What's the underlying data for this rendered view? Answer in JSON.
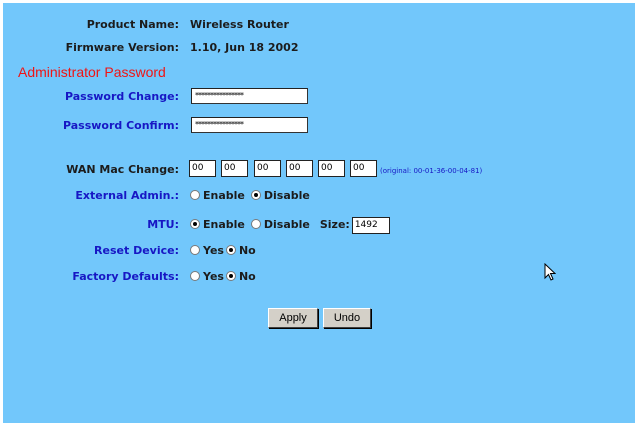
{
  "product": {
    "label": "Product Name:",
    "value": "Wireless Router"
  },
  "firmware": {
    "label": "Firmware Version:",
    "value": "1.10, Jun 18 2002"
  },
  "section_title": "Administrator Password",
  "password_change": {
    "label": "Password Change:",
    "value": "****************"
  },
  "password_confirm": {
    "label": "Password Confirm:",
    "value": "****************"
  },
  "wan_mac": {
    "label": "WAN Mac Change:",
    "octets": [
      "00",
      "00",
      "00",
      "00",
      "00",
      "00"
    ],
    "original_note": "(original: 00-01-36-00-04-81)"
  },
  "external_admin": {
    "label": "External Admin.:",
    "enable": "Enable",
    "disable": "Disable",
    "selected": "Disable"
  },
  "mtu": {
    "label": "MTU:",
    "enable": "Enable",
    "disable": "Disable",
    "selected": "Enable",
    "size_label": "Size:",
    "size_value": "1492"
  },
  "reset_device": {
    "label": "Reset Device:",
    "yes": "Yes",
    "no": "No",
    "selected": "No"
  },
  "factory_defaults": {
    "label": "Factory Defaults:",
    "yes": "Yes",
    "no": "No",
    "selected": "No"
  },
  "buttons": {
    "apply": "Apply",
    "undo": "Undo"
  },
  "colors": {
    "background": "#72c7fb",
    "section_title": "#f01414",
    "field_label": "#1717c4"
  },
  "icons": {
    "cursor": "mouse-pointer-icon"
  }
}
